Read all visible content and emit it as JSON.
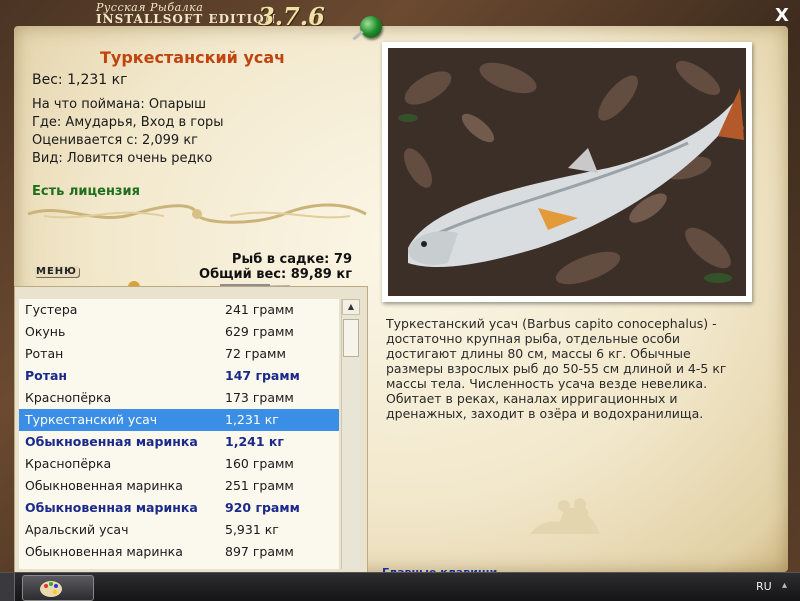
{
  "window": {
    "title_line1": "Русская Рыбалка",
    "title_line2": "INSTALLSOFT EDITION",
    "version": "3.7.6",
    "close_label": "X"
  },
  "fish": {
    "name": "Туркестанский усач",
    "weight_line": "Вес: 1,231 кг",
    "bait_line": "На что поймана: Опарыш",
    "place_line": "Где: Амударья, Вход в горы",
    "value_line": "Оценивается с: 2,099 кг",
    "rarity_line": "Вид: Ловится очень редко",
    "license": "Есть лицензия",
    "description": "Туркестанский усач (Barbus capito conocephalus) - достаточно крупная рыба, отдельные особи достигают длины 80 см, массы 6 кг. Обычные размеры взрослых рыб до 50-55 см длиной и 4-5 кг массы тела. Численность усача везде невелика. Обитает в реках, каналах ирригационных и дренажных, заходит в озёра и водохранилища.",
    "photo_icon": "fish-photo"
  },
  "stats": {
    "count_line": "Рыб в садке: 79",
    "total_line": "Общий вес: 89,89 кг"
  },
  "menu_label": "МЕНЮ",
  "bottom_link": "Главные клавиши",
  "catch_list": [
    {
      "name": "Густера",
      "weight": "241 грамм",
      "bold": false,
      "selected": false
    },
    {
      "name": "Окунь",
      "weight": "629 грамм",
      "bold": false,
      "selected": false
    },
    {
      "name": "Ротан",
      "weight": "72 грамм",
      "bold": false,
      "selected": false
    },
    {
      "name": "Ротан",
      "weight": "147 грамм",
      "bold": true,
      "selected": false
    },
    {
      "name": "Краснопёрка",
      "weight": "173 грамм",
      "bold": false,
      "selected": false
    },
    {
      "name": "Туркестанский усач",
      "weight": "1,231 кг",
      "bold": false,
      "selected": true
    },
    {
      "name": "Обыкновенная маринка",
      "weight": "1,241 кг",
      "bold": true,
      "selected": false
    },
    {
      "name": "Краснопёрка",
      "weight": "160 грамм",
      "bold": false,
      "selected": false
    },
    {
      "name": "Обыкновенная маринка",
      "weight": "251 грамм",
      "bold": false,
      "selected": false
    },
    {
      "name": "Обыкновенная маринка",
      "weight": "920 грамм",
      "bold": true,
      "selected": false
    },
    {
      "name": "Аральский усач",
      "weight": "5,931 кг",
      "bold": false,
      "selected": false
    },
    {
      "name": "Обыкновенная маринка",
      "weight": "897 грамм",
      "bold": false,
      "selected": false
    }
  ],
  "taskbar": {
    "language": "RU",
    "tray_icon": "chevron-up-icon",
    "app_icon": "paint-palette-icon"
  },
  "colors": {
    "title": "#c0440e",
    "license": "#1e6e1a",
    "bold_row": "#1b2a8a",
    "selected_row": "#3a8ee6"
  }
}
